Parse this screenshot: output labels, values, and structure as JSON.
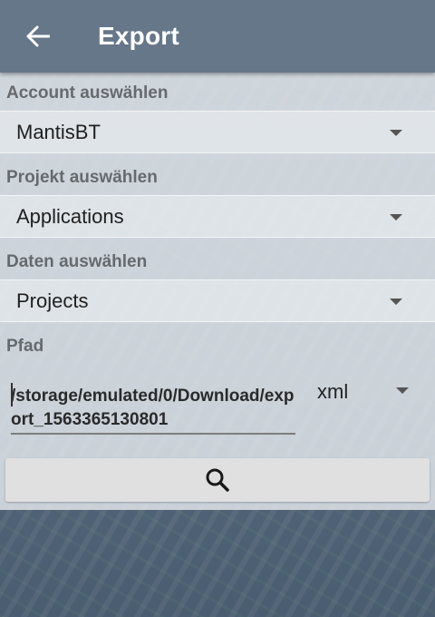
{
  "appbar": {
    "title": "Export",
    "back_icon": "arrow-left-icon"
  },
  "account": {
    "label": "Account auswählen",
    "selected": "MantisBT"
  },
  "project": {
    "label": "Projekt auswählen",
    "selected": "Applications"
  },
  "data": {
    "label": "Daten auswählen",
    "selected": "Projects"
  },
  "path": {
    "label": "Pfad",
    "value": "/storage/emulated/0/Download/export_1563365130801",
    "format": "xml"
  },
  "search_button": {
    "icon": "search-icon"
  },
  "colors": {
    "appbar": "#667789",
    "panel": "#e8ecf0"
  }
}
